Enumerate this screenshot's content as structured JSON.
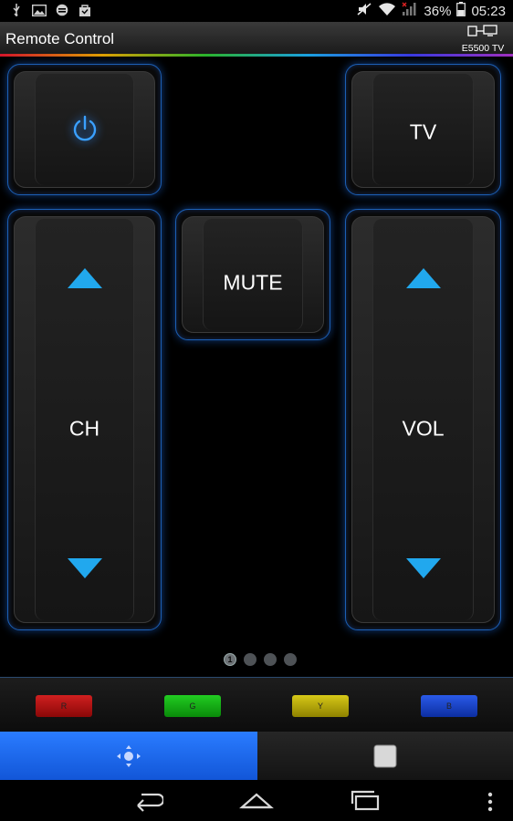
{
  "status_bar": {
    "left_icons": [
      "usb-icon",
      "image-icon",
      "shield-icon",
      "bag-icon"
    ],
    "right_icons": [
      "mute-icon",
      "wifi-icon",
      "signal-icon",
      "battery-icon"
    ],
    "battery": "36%",
    "time": "05:23"
  },
  "app": {
    "title": "Remote Control",
    "device_label": "E5500 TV"
  },
  "remote": {
    "power_icon": "power-icon",
    "tv_label": "TV",
    "mute_label": "MUTE",
    "ch_label": "CH",
    "vol_label": "VOL",
    "accent_color": "#21a8ee",
    "border_color": "#1c5fb4"
  },
  "pager": {
    "current": "1",
    "total_pages": 4
  },
  "color_keys": [
    {
      "label": "R",
      "color": "#b01010"
    },
    {
      "label": "G",
      "color": "#10a010"
    },
    {
      "label": "Y",
      "color": "#b0a000"
    },
    {
      "label": "B",
      "color": "#1040c0"
    }
  ],
  "tabs": [
    {
      "name": "dpad-tab",
      "icon": "dpad-icon",
      "active": true
    },
    {
      "name": "keypad-tab",
      "icon": "square-icon",
      "active": false
    }
  ],
  "nav": [
    "back-icon",
    "home-icon",
    "recent-apps-icon",
    "menu-icon"
  ]
}
